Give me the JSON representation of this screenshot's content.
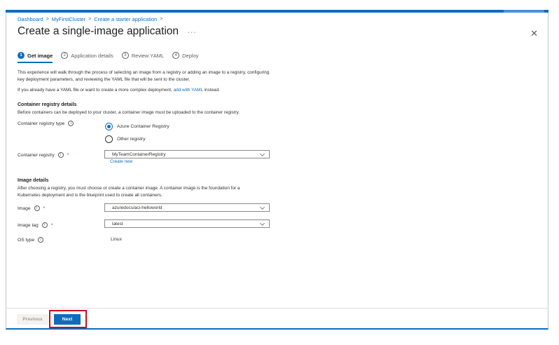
{
  "breadcrumb": {
    "items": [
      "Dashboard",
      "MyFirstCluster",
      "Create a starter application"
    ]
  },
  "header": {
    "title": "Create a single-image application",
    "more": "···",
    "close": "✕"
  },
  "tabs": [
    {
      "num": "1",
      "label": "Get image"
    },
    {
      "num": "2",
      "label": "Application details"
    },
    {
      "num": "3",
      "label": "Review YAML"
    },
    {
      "num": "4",
      "label": "Deploy"
    }
  ],
  "intro": {
    "p1": "This experience will walk through the process of selecting an image from a registry or adding an image to a registry, configuring key deployment parameters, and reviewing the YAML file that will be sent to the cluster.",
    "p2_before": "If you already have a YAML file or want to create a more complex deployment, ",
    "p2_link": "add with YAML",
    "p2_after": " instead."
  },
  "registry_section": {
    "heading": "Container registry details",
    "desc": "Before containers can be deployed to your cluster, a container image must be uploaded to the container registry.",
    "type_label": "Container registry type",
    "options": [
      "Azure Container Registry",
      "Other registry"
    ],
    "registry_label": "Container registry",
    "registry_value": "MyTeamContainerRegistry",
    "create_new": "Create new"
  },
  "image_section": {
    "heading": "Image details",
    "desc": "After choosing a registry, you must choose or create a container image. A container image is the foundation for a Kubernetes deployment and is the blueprint used to create all containers.",
    "image_label": "Image",
    "image_value": "azuredocs/aci-helloworld",
    "tag_label": "Image tag",
    "tag_value": "latest",
    "os_label": "OS type",
    "os_value": "Linux"
  },
  "footer": {
    "previous": "Previous",
    "next": "Next"
  },
  "icons": {
    "info": "info-icon",
    "chevron": "chevron-down-icon",
    "close": "close-icon"
  },
  "colors": {
    "accent": "#0f6cbd",
    "highlight": "#c50f1f",
    "required": "#a4262c"
  }
}
